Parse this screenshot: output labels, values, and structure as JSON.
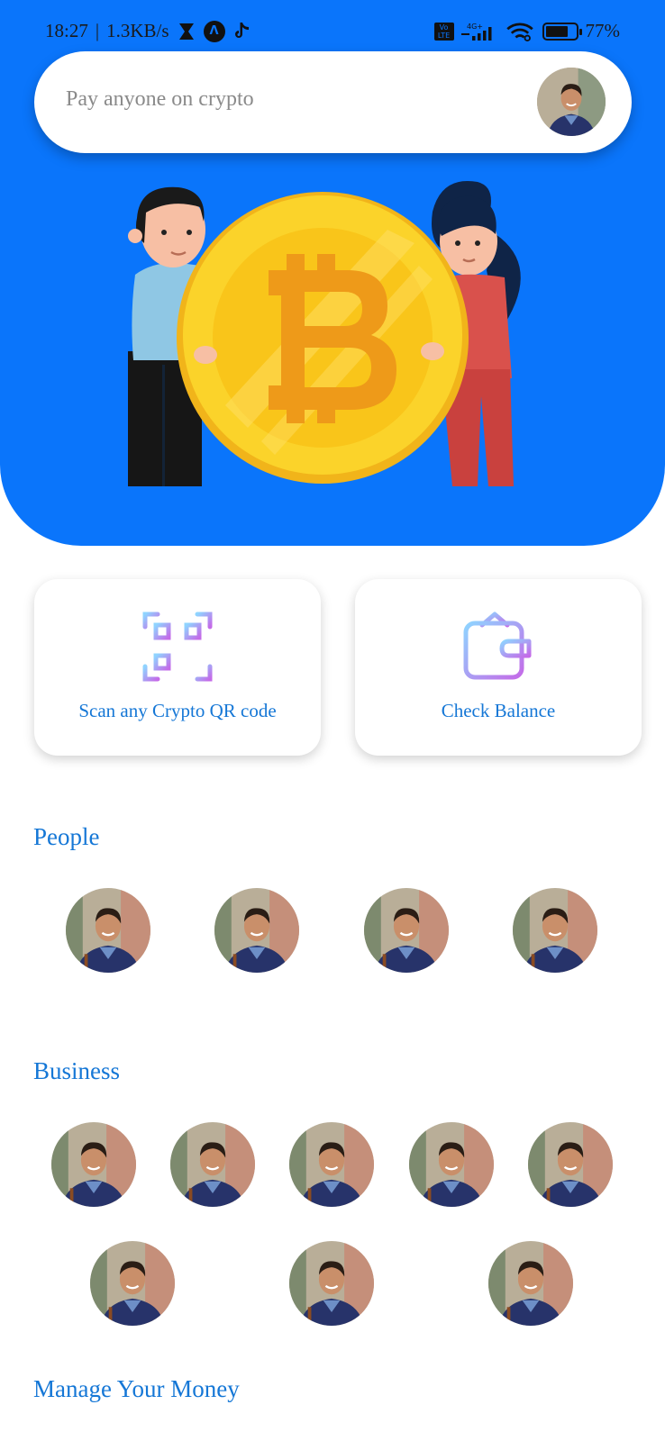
{
  "status_bar": {
    "time": "18:27",
    "separator": "|",
    "speed": "1.3KB/s",
    "network": "4G+",
    "volte": "Vo LTE",
    "battery": "77%",
    "battery_level": 0.77
  },
  "search": {
    "placeholder": "Pay anyone on crypto"
  },
  "actions": [
    {
      "label": "Scan any Crypto QR code",
      "icon": "qr-code-icon"
    },
    {
      "label": "Check Balance",
      "icon": "wallet-icon"
    }
  ],
  "sections": {
    "people": "People",
    "business": "Business",
    "manage": "Manage Your Money"
  },
  "colors": {
    "hero_blue": "#0a75fb",
    "accent_text": "#1577d6",
    "coin_gold": "#f9c51a"
  }
}
